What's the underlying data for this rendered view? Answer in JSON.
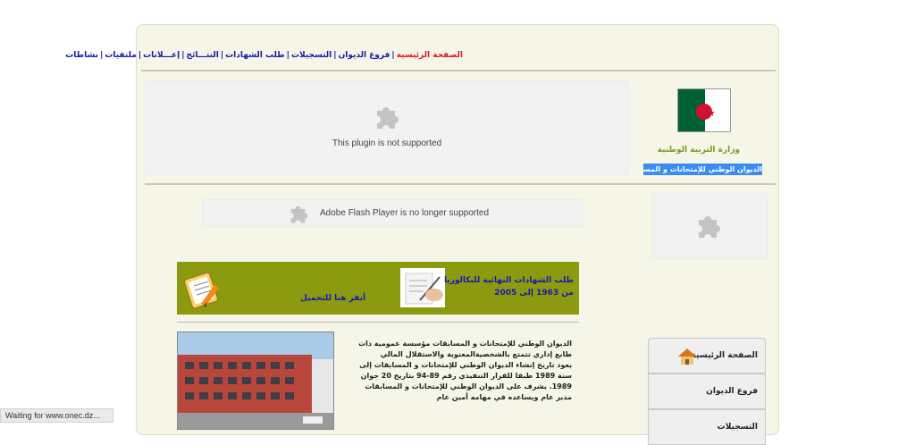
{
  "nav": {
    "items": [
      "الصفحة الرئيسية",
      "فروع الديوان",
      "التسجيلات",
      "طلب الشهادات",
      "النتـــائج",
      "إعـــلانات",
      "ملتقيات",
      "نشاطات"
    ]
  },
  "header": {
    "ministry": "وزارة التربية الوطنية",
    "office": "الديوان الوطني للإمتحانات و المسابقات"
  },
  "plugins": {
    "main_message": "This plugin is not supported",
    "flash_message": "Adobe Flash Player is no longer supported"
  },
  "banner": {
    "text": "طلب الشهادات النهائية للبكالوريا من 1963 إلى 2005",
    "link": "أنقر هنا للتحميل"
  },
  "intro": {
    "p1": "الديوان الوطني للإمتحانات و المسابقات مؤسسة عمومية ذات طابع إداري تتمتع بالشخصيةالمعنوية والاستقلال المالي",
    "p2": "يعود تاريخ إنشاء الديوان الوطني للإمتحانات و المسابقات إلى سنة 1989 طبقا للقرار التنفيذي رقم 89-94 بتاريخ 20 جوان 1989. يشرف على الديوان الوطني للإمتحانات و المسابقات مدير عام ويساعده في مهامه أمين عام"
  },
  "sidemenu": {
    "items": [
      "الصفحة الرئيسية",
      "فروع الديوان",
      "التسجيلات"
    ]
  },
  "status": {
    "text": "Waiting for www.onec.dz..."
  },
  "colors": {
    "frame_bg": "#f5f5e8",
    "banner_bg": "#8c9a10",
    "nav_link": "#1a1aa8",
    "nav_home": "#d81a1a",
    "badge_bg": "#3a8cf0"
  }
}
